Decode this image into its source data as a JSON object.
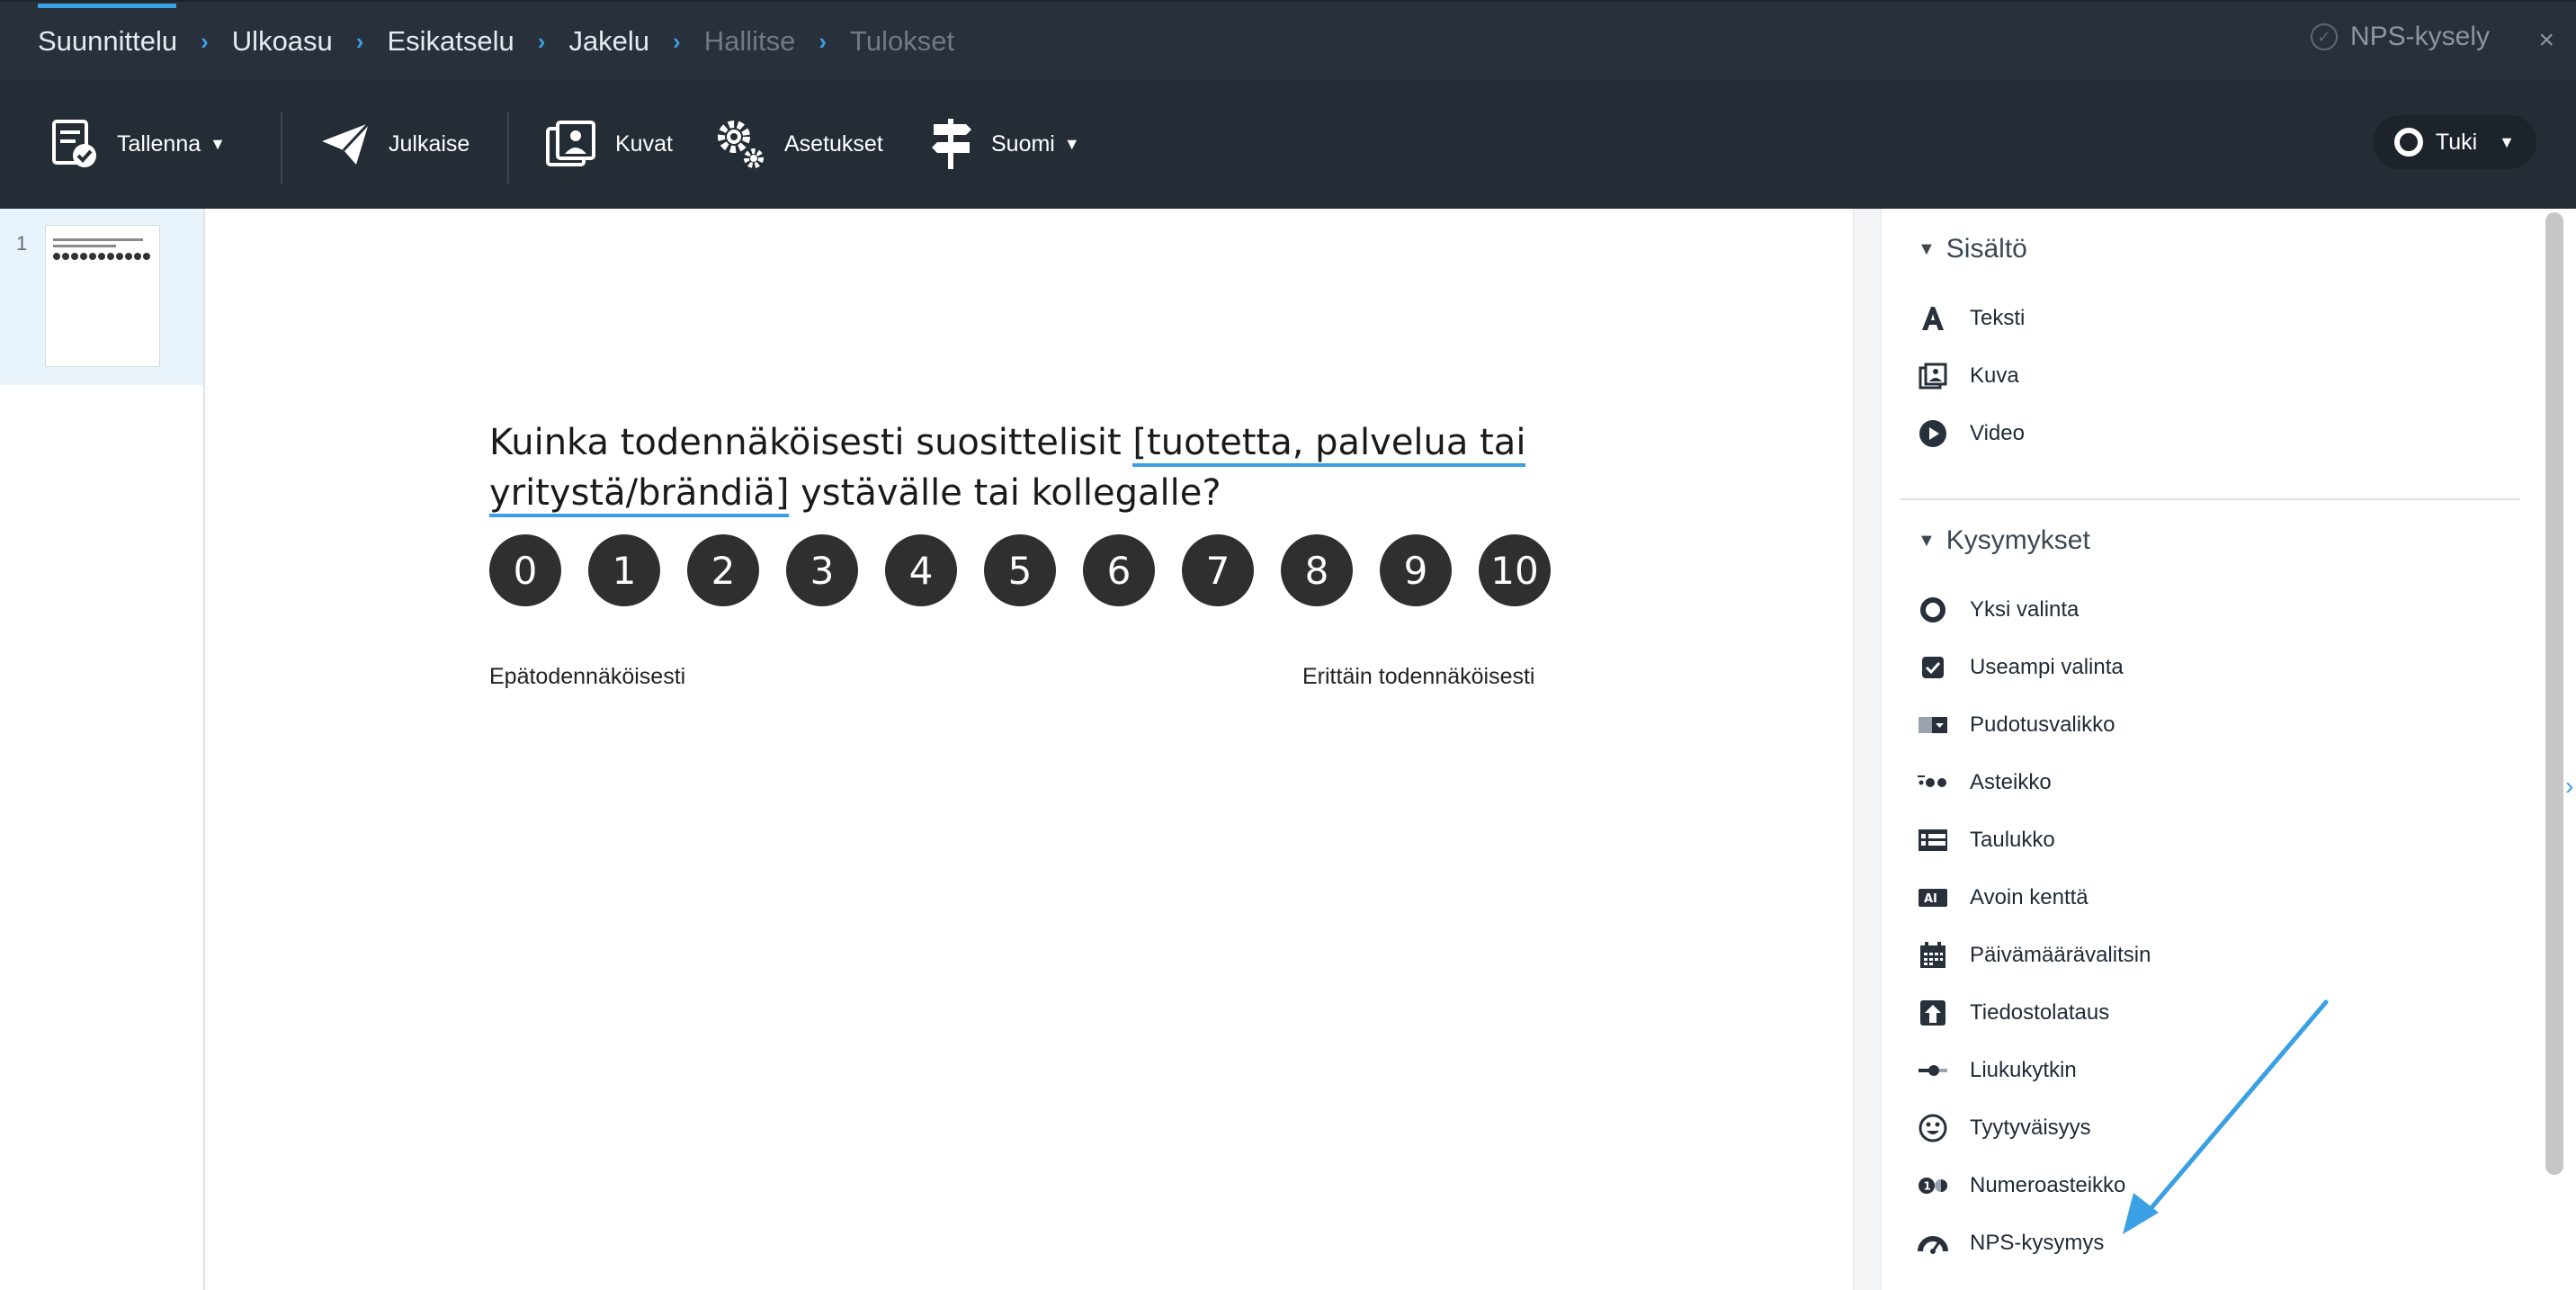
{
  "nav": {
    "crumbs": [
      "Suunnittelu",
      "Ulkoasu",
      "Esikatselu",
      "Jakelu",
      "Hallitse",
      "Tulokset"
    ],
    "survey_name": "NPS-kysely",
    "close": "×"
  },
  "toolbar": {
    "save": "Tallenna",
    "publish": "Julkaise",
    "images": "Kuvat",
    "settings": "Asetukset",
    "language": "Suomi",
    "support": "Tuki"
  },
  "pages": {
    "current": "1"
  },
  "question": {
    "text_before": "Kuinka todennäköisesti suosittelisit ",
    "placeholder": "[tuotetta, palvelua tai yritystä/brändiä]",
    "text_after": " ystävälle tai kollegalle?",
    "scale": [
      "0",
      "1",
      "2",
      "3",
      "4",
      "5",
      "6",
      "7",
      "8",
      "9",
      "10"
    ],
    "label_low": "Epätodennäköisesti",
    "label_high": "Erittäin todennäköisesti"
  },
  "sidebar": {
    "content_title": "Sisältö",
    "content_items": [
      {
        "label": "Teksti",
        "icon": "text-icon"
      },
      {
        "label": "Kuva",
        "icon": "image-icon"
      },
      {
        "label": "Video",
        "icon": "video-icon"
      }
    ],
    "questions_title": "Kysymykset",
    "question_items": [
      {
        "label": "Yksi valinta",
        "icon": "radio-icon"
      },
      {
        "label": "Useampi valinta",
        "icon": "checkbox-icon"
      },
      {
        "label": "Pudotusvalikko",
        "icon": "dropdown-icon"
      },
      {
        "label": "Asteikko",
        "icon": "scale-icon"
      },
      {
        "label": "Taulukko",
        "icon": "table-icon"
      },
      {
        "label": "Avoin kenttä",
        "icon": "text-field-icon"
      },
      {
        "label": "Päivämäärävalitsin",
        "icon": "calendar-icon"
      },
      {
        "label": "Tiedostolataus",
        "icon": "upload-icon"
      },
      {
        "label": "Liukukytkin",
        "icon": "slider-icon"
      },
      {
        "label": "Tyytyväisyys",
        "icon": "smiley-icon"
      },
      {
        "label": "Numeroasteikko",
        "icon": "number-scale-icon"
      },
      {
        "label": "NPS-kysymys",
        "icon": "gauge-icon"
      }
    ]
  },
  "colors": {
    "accent": "#3aa0e3",
    "nav_bg": "#27303b",
    "toolbar_bg": "#242c36",
    "nps_button": "#2f2f2f"
  }
}
